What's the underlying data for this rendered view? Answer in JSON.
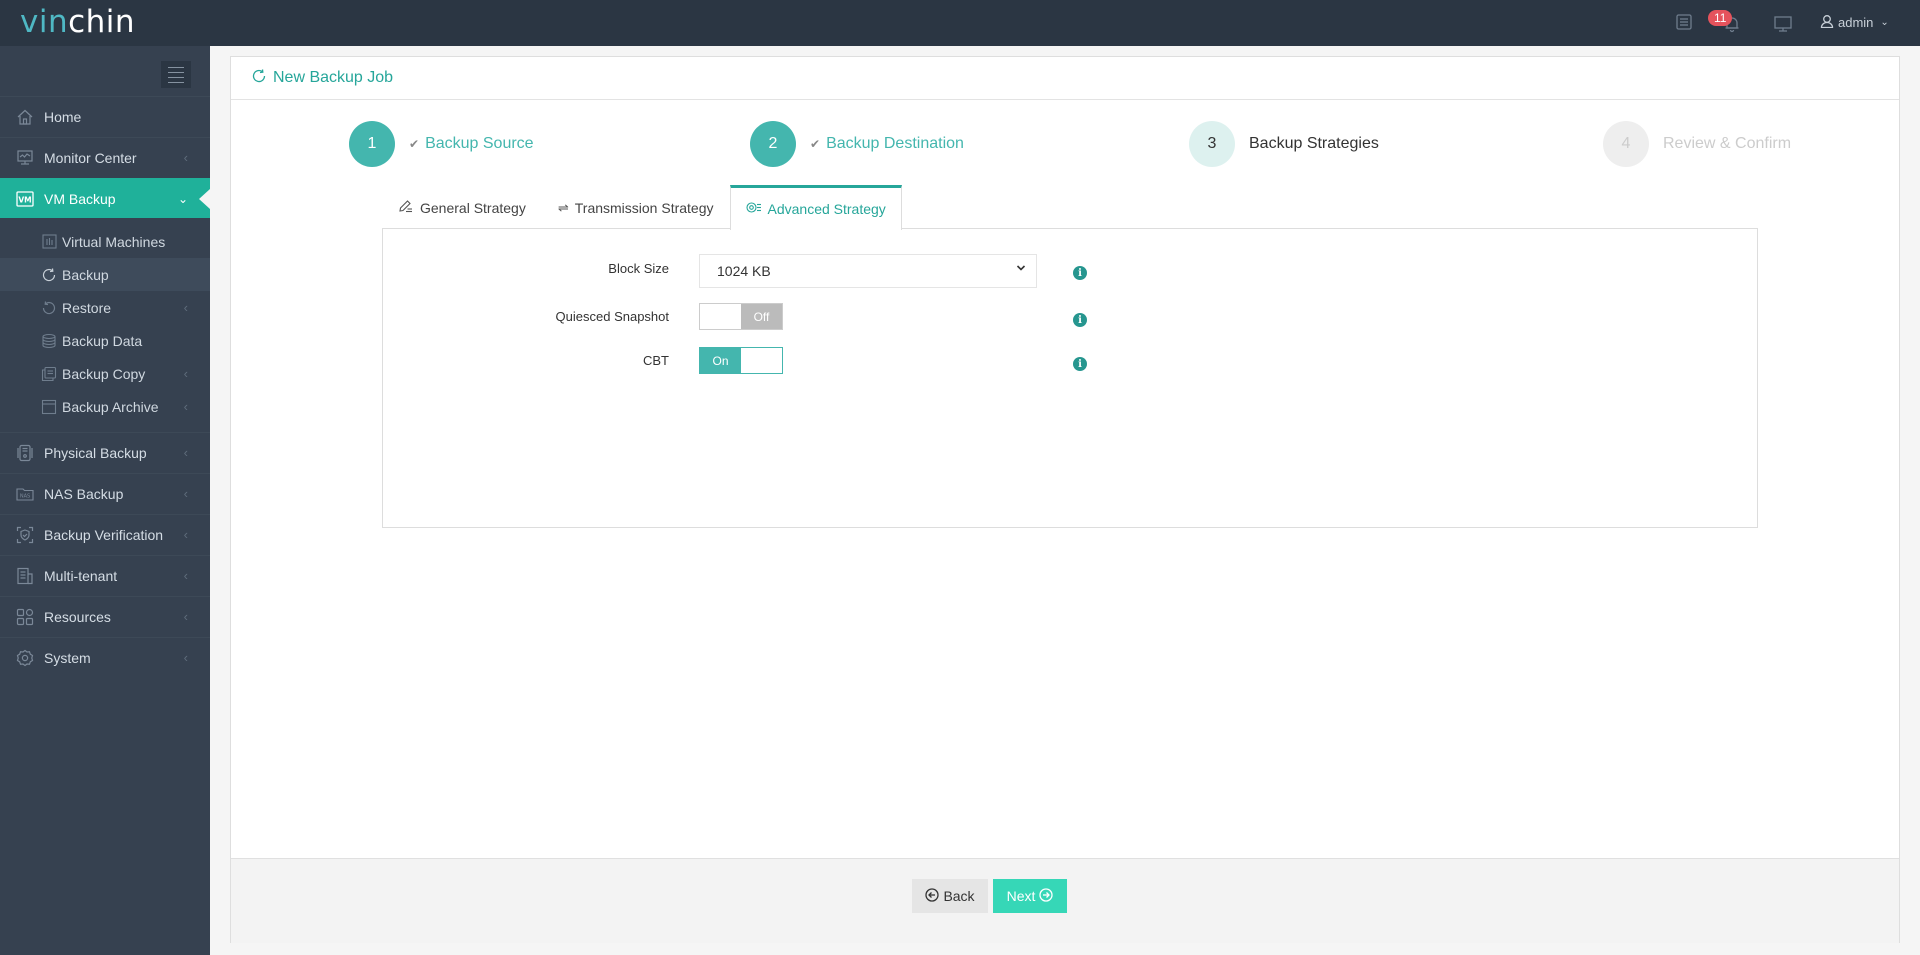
{
  "app": {
    "logo_part1": "vin",
    "logo_part2": "chin"
  },
  "header": {
    "notification_count": "11",
    "user": "admin",
    "icons": [
      "task-list-icon",
      "bell-icon",
      "monitor-icon",
      "user-icon"
    ]
  },
  "sidebar": {
    "items": [
      {
        "label": "Home",
        "icon": "home-icon",
        "has_arrow": false
      },
      {
        "label": "Monitor Center",
        "icon": "monitor-center-icon",
        "has_arrow": true
      },
      {
        "label": "VM Backup",
        "icon": "vm-icon",
        "has_arrow": true,
        "expanded": true
      },
      {
        "label": "Physical Backup",
        "icon": "physical-server-icon",
        "has_arrow": true
      },
      {
        "label": "NAS Backup",
        "icon": "nas-icon",
        "has_arrow": true
      },
      {
        "label": "Backup Verification",
        "icon": "shield-check-icon",
        "has_arrow": true
      },
      {
        "label": "Multi-tenant",
        "icon": "building-icon",
        "has_arrow": true
      },
      {
        "label": "Resources",
        "icon": "resources-icon",
        "has_arrow": true
      },
      {
        "label": "System",
        "icon": "gear-icon",
        "has_arrow": true
      }
    ],
    "subitems": [
      {
        "label": "Virtual Machines",
        "icon": "vm-list-icon",
        "has_arrow": false
      },
      {
        "label": "Backup",
        "icon": "refresh-icon",
        "has_arrow": false,
        "current": true
      },
      {
        "label": "Restore",
        "icon": "restore-icon",
        "has_arrow": true
      },
      {
        "label": "Backup Data",
        "icon": "database-icon",
        "has_arrow": false
      },
      {
        "label": "Backup Copy",
        "icon": "copy-icon",
        "has_arrow": true
      },
      {
        "label": "Backup Archive",
        "icon": "archive-icon",
        "has_arrow": true
      }
    ]
  },
  "page": {
    "title": "New Backup Job",
    "steps": [
      {
        "number": "1",
        "label": "Backup Source",
        "state": "done"
      },
      {
        "number": "2",
        "label": "Backup Destination",
        "state": "done"
      },
      {
        "number": "3",
        "label": "Backup Strategies",
        "state": "current"
      },
      {
        "number": "4",
        "label": "Review & Confirm",
        "state": "todo"
      }
    ],
    "tabs": [
      {
        "label": "General Strategy",
        "icon": "pencil-icon",
        "active": false
      },
      {
        "label": "Transmission Strategy",
        "icon": "transfer-icon",
        "active": false
      },
      {
        "label": "Advanced Strategy",
        "icon": "advanced-settings-icon",
        "active": true
      }
    ],
    "form": {
      "block_size": {
        "label": "Block Size",
        "value": "1024 KB"
      },
      "quiesced_snapshot": {
        "label": "Quiesced Snapshot",
        "state": "Off"
      },
      "cbt": {
        "label": "CBT",
        "state": "On"
      }
    },
    "footer": {
      "back_label": "Back",
      "next_label": "Next"
    }
  },
  "colors": {
    "accent": "#44b6ae",
    "sidebar_active": "#1fb19a",
    "next_button": "#36d7b7",
    "header_bg": "#2b3643",
    "sidebar_bg": "#364150",
    "badge": "#e5535c"
  }
}
